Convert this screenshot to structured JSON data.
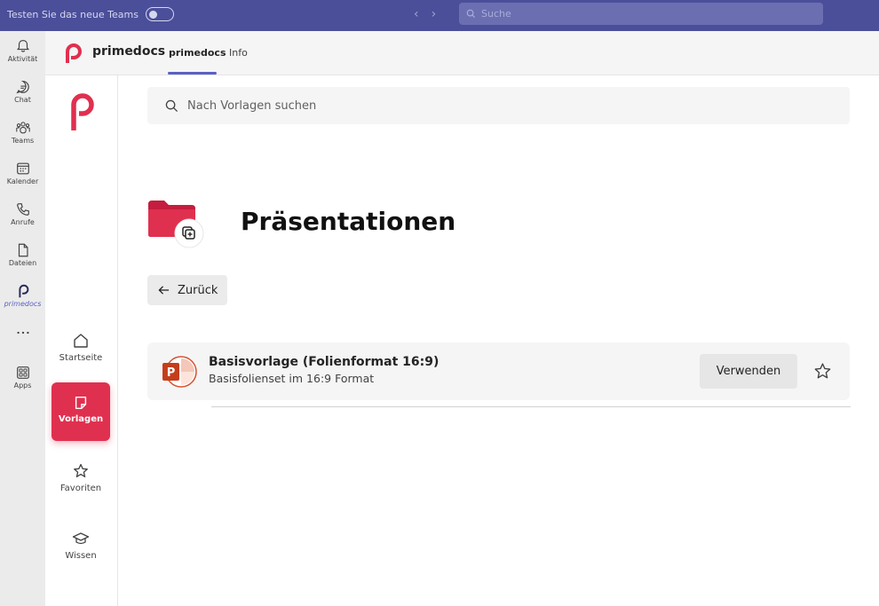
{
  "topbar": {
    "new_teams_label": "Testen Sie das neue Teams",
    "search_placeholder": "Suche"
  },
  "rail": {
    "items": [
      {
        "label": "Aktivität",
        "icon": "bell-icon"
      },
      {
        "label": "Chat",
        "icon": "chat-icon"
      },
      {
        "label": "Teams",
        "icon": "teams-icon"
      },
      {
        "label": "Kalender",
        "icon": "calendar-icon"
      },
      {
        "label": "Anrufe",
        "icon": "phone-icon"
      },
      {
        "label": "Dateien",
        "icon": "file-icon"
      },
      {
        "label": "primedocs",
        "icon": "primedocs-icon"
      },
      {
        "label": "Apps",
        "icon": "apps-icon"
      }
    ]
  },
  "app": {
    "name": "primedocs",
    "tabs": [
      {
        "label": "primedocs",
        "active": true
      },
      {
        "label": "Info",
        "active": false
      }
    ]
  },
  "sidebar": {
    "items": [
      {
        "label": "Startseite",
        "icon": "home-icon"
      },
      {
        "label": "Vorlagen",
        "icon": "template-icon",
        "active": true
      },
      {
        "label": "Favoriten",
        "icon": "star-icon"
      },
      {
        "label": "Wissen",
        "icon": "graduation-cap-icon"
      }
    ]
  },
  "main": {
    "search_placeholder": "Nach Vorlagen suchen",
    "page_title": "Präsentationen",
    "back_label": "Zurück",
    "templates": [
      {
        "title": "Basisvorlage (Folienformat 16:9)",
        "subtitle": "Basisfolienset im 16:9 Format",
        "use_label": "Verwenden",
        "icon": "powerpoint-icon"
      }
    ]
  },
  "colors": {
    "teams_purple": "#4b4f9a",
    "accent_red": "#e0304f",
    "tab_underline": "#5b5fc7"
  }
}
